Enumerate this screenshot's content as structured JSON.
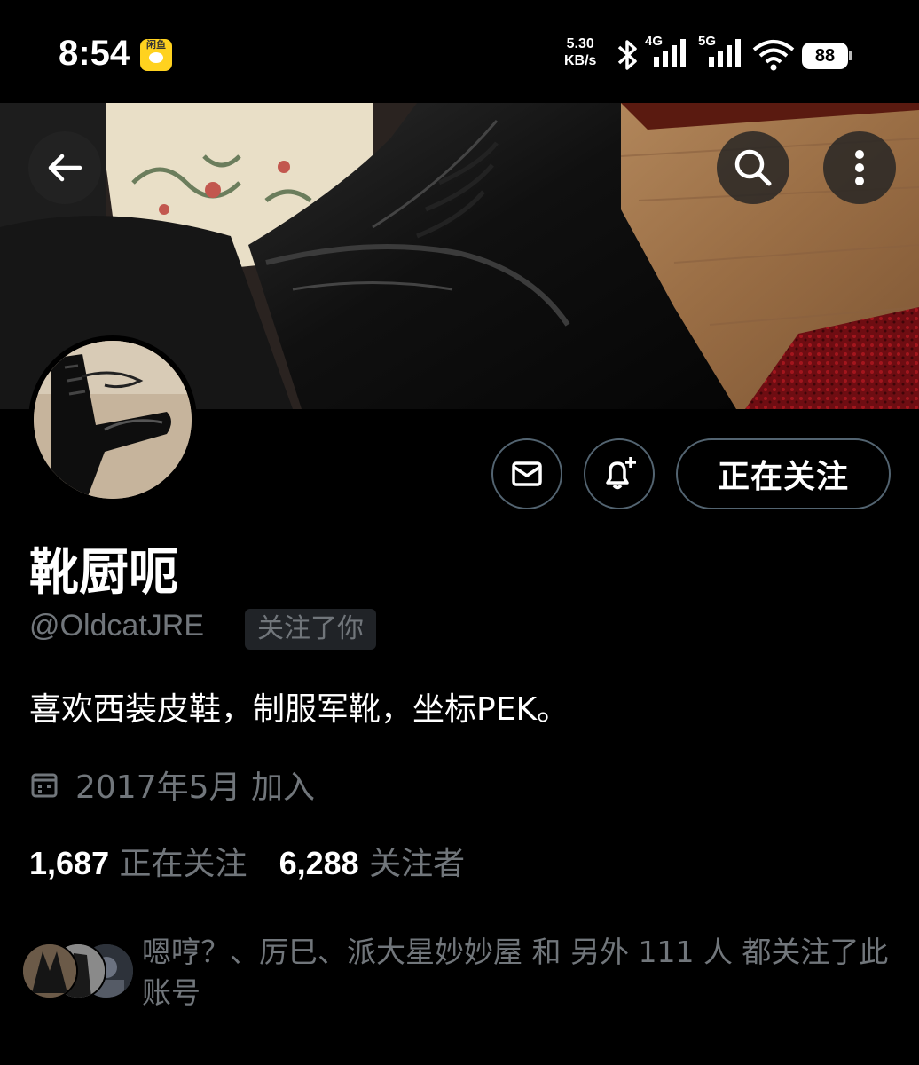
{
  "status_bar": {
    "time": "8:54",
    "app_badge": "闲鱼",
    "net_speed_value": "5.30",
    "net_speed_unit": "KB/s",
    "bluetooth_icon": "bluetooth-icon",
    "network_1": "4G",
    "network_2": "5G",
    "wifi_icon": "wifi-icon",
    "battery": "88"
  },
  "header": {
    "back_icon": "arrow-left-icon",
    "search_icon": "search-icon",
    "more_icon": "more-vertical-icon"
  },
  "profile": {
    "display_name": "靴厨呃",
    "handle": "@OldcatJRE",
    "follows_you": "关注了你",
    "bio": "喜欢西装皮鞋，制服军靴，坐标PEK。",
    "joined": "2017年5月 加入",
    "following_count": "1,687",
    "following_label": "正在关注",
    "followers_count": "6,288",
    "followers_label": "关注者"
  },
  "actions": {
    "message_icon": "mail-icon",
    "notify_icon": "bell-plus-icon",
    "follow_state": "正在关注"
  },
  "mutual": {
    "text": "嗯哼？、厉巳、派大星妙妙屋 和 另外 111 人 都关注了此账号"
  },
  "colors": {
    "background": "#000000",
    "text_primary": "#e7e9ea",
    "text_secondary": "#71767b",
    "border": "#536471"
  }
}
